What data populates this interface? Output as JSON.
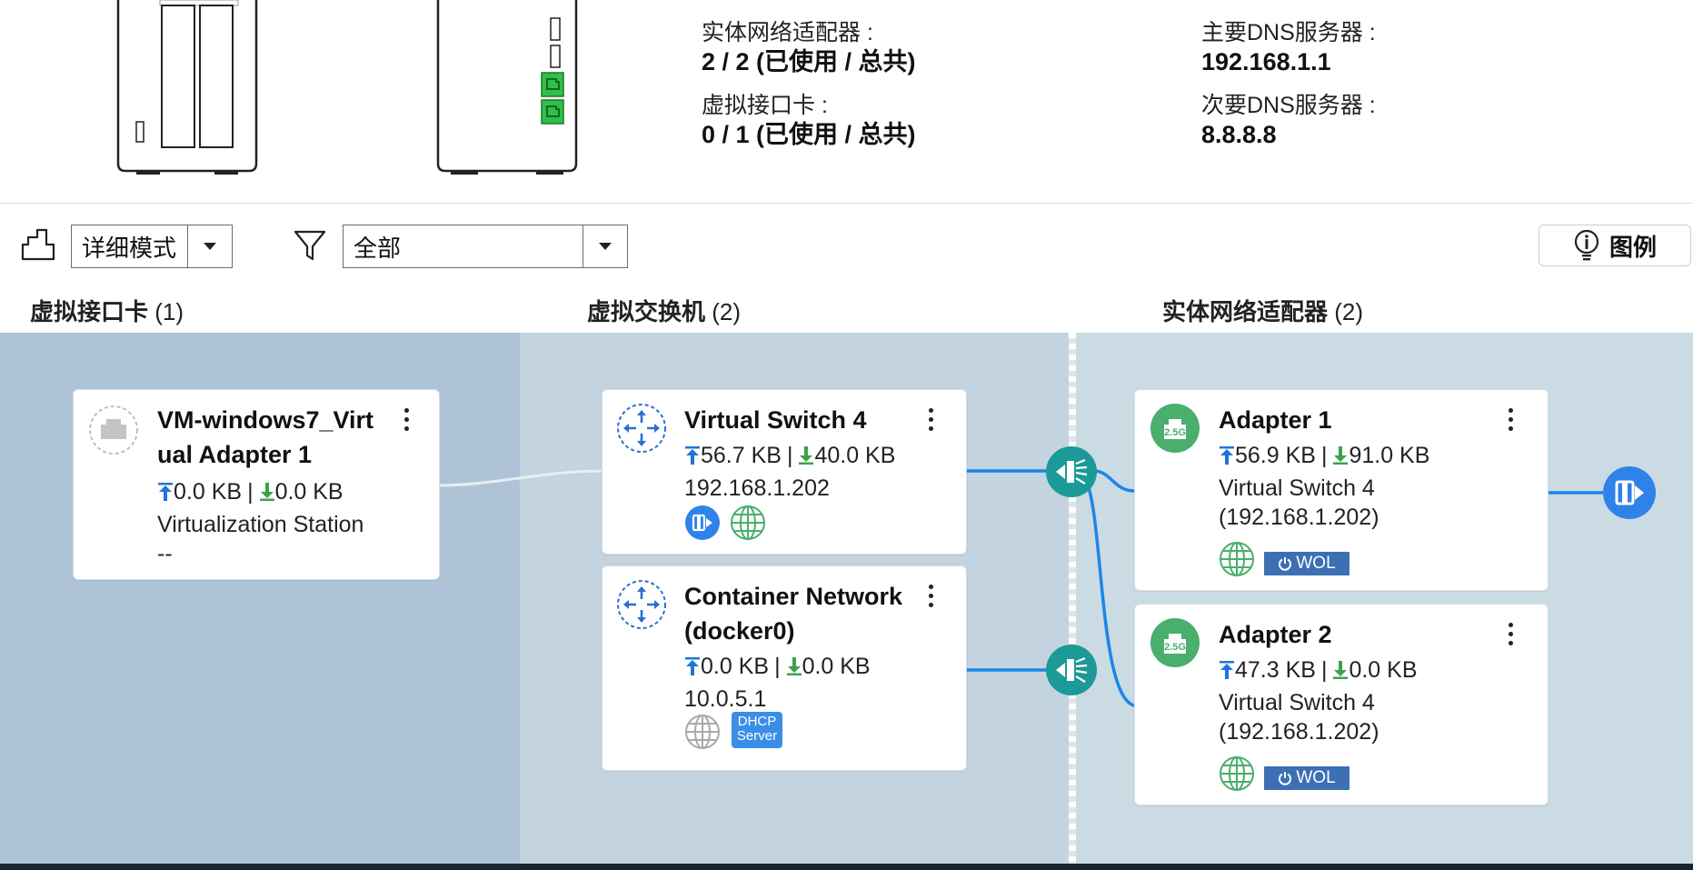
{
  "summary": {
    "physical_adapters_label": "实体网络适配器 :",
    "physical_adapters_value": "2 / 2 (已使用 / 总共)",
    "virtual_nics_label": "虚拟接口卡 :",
    "virtual_nics_value": "0 / 1 (已使用 / 总共)",
    "primary_dns_label": "主要DNS服务器 :",
    "primary_dns_value": "192.168.1.1",
    "secondary_dns_label": "次要DNS服务器 :",
    "secondary_dns_value": "8.8.8.8"
  },
  "toolbar": {
    "mode_value": "详细模式",
    "filter_value": "全部",
    "legend_label": "图例"
  },
  "columns": {
    "virtual_nics": {
      "label": "虚拟接口卡",
      "count": "(1)"
    },
    "virtual_switches": {
      "label": "虚拟交换机",
      "count": "(2)"
    },
    "physical_adapters": {
      "label": "实体网络适配器",
      "count": "(2)"
    }
  },
  "vnic_card": {
    "title_line1": "VM-windows7_Virt",
    "title_line2": "ual Adapter 1",
    "tx": "0.0 KB",
    "rx": "0.0 KB",
    "sep": "|",
    "app": "Virtualization Station",
    "detail": "--"
  },
  "switch_cards": [
    {
      "title_line1": "Virtual Switch 4",
      "tx": "56.7 KB",
      "rx": "40.0 KB",
      "sep": "|",
      "ip": "192.168.1.202"
    },
    {
      "title_line1": "Container Network",
      "title_line2": "(docker0)",
      "tx": "0.0 KB",
      "rx": "0.0 KB",
      "sep": "|",
      "ip": "10.0.5.1",
      "dhcp_line1": "DHCP",
      "dhcp_line2": "Server"
    }
  ],
  "adapter_cards": [
    {
      "title": "Adapter 1",
      "badge": "2.5G",
      "tx": "56.9 KB",
      "rx": "91.0 KB",
      "sep": "|",
      "switch_line1": "Virtual Switch 4",
      "switch_line2": "(192.168.1.202)",
      "wol": "WOL"
    },
    {
      "title": "Adapter 2",
      "badge": "2.5G",
      "tx": "47.3 KB",
      "rx": "0.0 KB",
      "sep": "|",
      "switch_line1": "Virtual Switch 4",
      "switch_line2": "(192.168.1.202)",
      "wol": "WOL"
    }
  ],
  "colors": {
    "upload_arrow": "#1f74d8",
    "download_arrow": "#3aa34a",
    "wire": "#1a86ea",
    "teal_node": "#1b9a97",
    "adapter_green": "#4aae6c",
    "wol_bg": "#3d6fb4"
  },
  "icons": {
    "topology": "topology-icon",
    "filter": "filter-icon",
    "legend": "lightbulb-info-icon",
    "switch": "virtual-switch-icon",
    "globe": "globe-icon",
    "external": "external-port-icon",
    "bridge": "bridge-node-icon",
    "power": "power-icon"
  }
}
